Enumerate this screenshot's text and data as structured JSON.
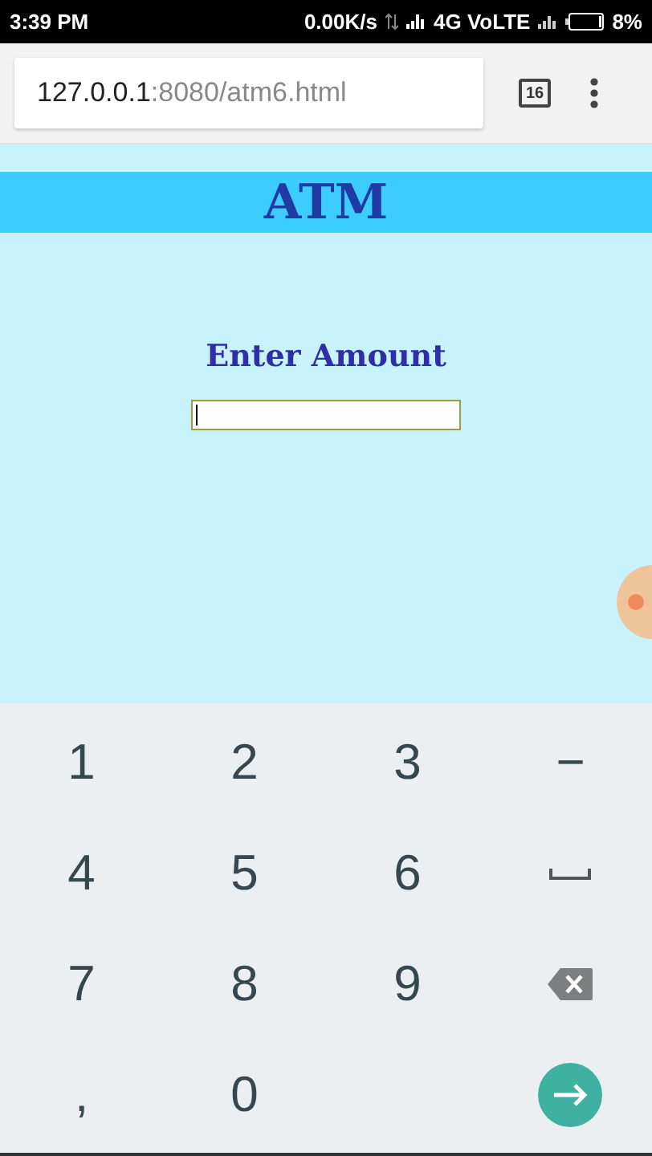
{
  "status_bar": {
    "time": "3:39 PM",
    "speed": "0.00K/s",
    "network": "4G VoLTE",
    "battery": "8%"
  },
  "browser": {
    "url_host": "127.0.0.1",
    "url_path": ":8080/atm6.html",
    "tab_count": "16"
  },
  "page": {
    "title": "ATM",
    "prompt": "Enter Amount",
    "amount_field": {
      "focused": true
    }
  },
  "keyboard": {
    "keys": [
      {
        "kind": "char",
        "label": "1"
      },
      {
        "kind": "char",
        "label": "2"
      },
      {
        "kind": "char",
        "label": "3"
      },
      {
        "kind": "char",
        "label": "−"
      },
      {
        "kind": "char",
        "label": "4"
      },
      {
        "kind": "char",
        "label": "5"
      },
      {
        "kind": "char",
        "label": "6"
      },
      {
        "kind": "space"
      },
      {
        "kind": "char",
        "label": "7"
      },
      {
        "kind": "char",
        "label": "8"
      },
      {
        "kind": "char",
        "label": "9"
      },
      {
        "kind": "backspace"
      },
      {
        "kind": "char",
        "label": ","
      },
      {
        "kind": "char",
        "label": "0"
      },
      {
        "kind": "blank"
      },
      {
        "kind": "go"
      }
    ]
  }
}
